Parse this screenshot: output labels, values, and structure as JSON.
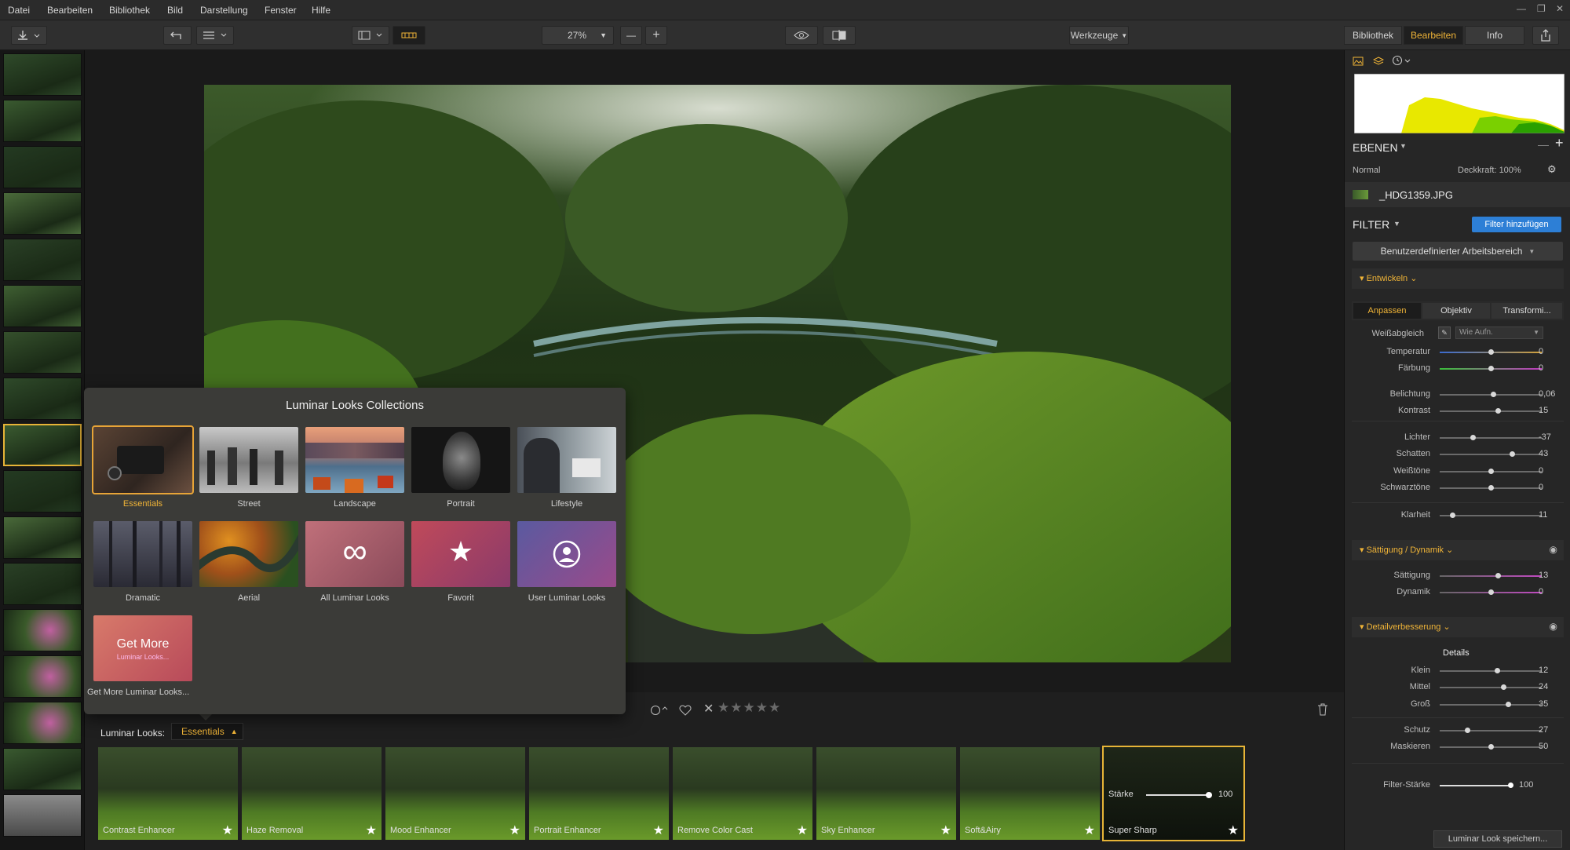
{
  "menu": [
    "Datei",
    "Bearbeiten",
    "Bibliothek",
    "Bild",
    "Darstellung",
    "Fenster",
    "Hilfe"
  ],
  "window_controls": [
    "—",
    "❐",
    "✕"
  ],
  "toolbar": {
    "zoom": "27%",
    "tools_label": "Werkzeuge",
    "tabs": [
      "Bibliothek",
      "Bearbeiten",
      "Info"
    ],
    "selected_tab": "Bearbeiten"
  },
  "popup": {
    "title": "Luminar Looks Collections",
    "collections": [
      {
        "label": "Essentials",
        "selected": true
      },
      {
        "label": "Street"
      },
      {
        "label": "Landscape"
      },
      {
        "label": "Portrait"
      },
      {
        "label": "Lifestyle"
      },
      {
        "label": "Dramatic"
      },
      {
        "label": "Aerial"
      },
      {
        "label": "All Luminar Looks"
      },
      {
        "label": "Favorit"
      },
      {
        "label": "User Luminar Looks"
      }
    ],
    "get_more": {
      "title": "Get More",
      "subtitle": "Luminar Looks...",
      "label": "Get More Luminar Looks..."
    }
  },
  "looks_bar": {
    "label": "Luminar Looks:",
    "collection": "Essentials",
    "looks": [
      "Contrast Enhancer",
      "Haze Removal",
      "Mood Enhancer",
      "Portrait Enhancer",
      "Remove Color Cast",
      "Sky Enhancer",
      "Soft&Airy",
      "Super Sharp"
    ],
    "active_look": "Super Sharp",
    "strength_label": "Stärke",
    "strength_value": "100",
    "rating_stars": "★★★★★"
  },
  "right_panel": {
    "layers_title": "EBENEN",
    "blend_mode": "Normal",
    "opacity": "Deckkraft: 100%",
    "layer_name": "_HDG1359.JPG",
    "filter_title": "FILTER",
    "add_filter": "Filter hinzufügen",
    "workspace": "Benutzerdefinierter Arbeitsbereich",
    "develop": {
      "title": "Entwickeln",
      "tabs": [
        "Anpassen",
        "Objektiv",
        "Transformi..."
      ],
      "wb_label": "Weißabgleich",
      "wb_value": "Wie Aufn.",
      "sliders": [
        {
          "label": "Temperatur",
          "value": "0",
          "pos": 0.5
        },
        {
          "label": "Färbung",
          "value": "0",
          "pos": 0.5
        },
        {
          "label": "Belichtung",
          "value": "0,06",
          "pos": 0.52
        },
        {
          "label": "Kontrast",
          "value": "15",
          "pos": 0.57
        },
        {
          "label": "Lichter",
          "value": "-37",
          "pos": 0.32
        },
        {
          "label": "Schatten",
          "value": "43",
          "pos": 0.71
        },
        {
          "label": "Weißtöne",
          "value": "0",
          "pos": 0.5
        },
        {
          "label": "Schwarztöne",
          "value": "0",
          "pos": 0.5
        },
        {
          "label": "Klarheit",
          "value": "11",
          "pos": 0.12
        }
      ]
    },
    "saturation": {
      "title": "Sättigung / Dynamik",
      "sliders": [
        {
          "label": "Sättigung",
          "value": "13",
          "pos": 0.57
        },
        {
          "label": "Dynamik",
          "value": "0",
          "pos": 0.5
        }
      ]
    },
    "detail": {
      "title": "Detailverbesserung",
      "subtitle": "Details",
      "sliders": [
        {
          "label": "Klein",
          "value": "12",
          "pos": 0.56
        },
        {
          "label": "Mittel",
          "value": "24",
          "pos": 0.62
        },
        {
          "label": "Groß",
          "value": "35",
          "pos": 0.67
        },
        {
          "label": "Schutz",
          "value": "27",
          "pos": 0.27
        },
        {
          "label": "Maskieren",
          "value": "50",
          "pos": 0.5
        }
      ]
    },
    "filter_strength": {
      "label": "Filter-Stärke",
      "value": "100",
      "pos": 1.0
    },
    "save_look": "Luminar Look speichern..."
  },
  "colors": {
    "accent": "#f0b437",
    "blue": "#2d7fd6"
  }
}
